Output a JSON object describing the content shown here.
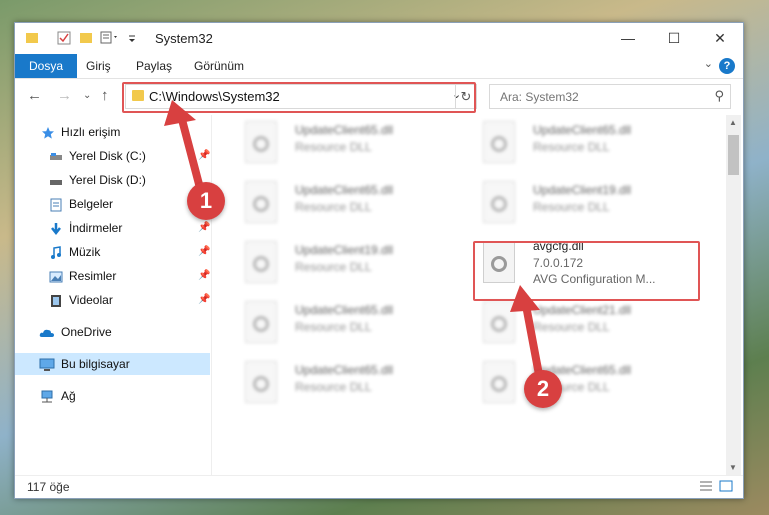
{
  "window": {
    "title": "System32"
  },
  "ribbon": {
    "tabs": [
      "Dosya",
      "Giriş",
      "Paylaş",
      "Görünüm"
    ],
    "help_label": "?"
  },
  "address": {
    "path": "C:\\Windows\\System32",
    "search_placeholder": "Ara: System32"
  },
  "sidebar": {
    "items": [
      {
        "label": "Hızlı erişim",
        "icon": "star-icon"
      },
      {
        "label": "Yerel Disk (C:)",
        "icon": "drive-icon",
        "pinned": true
      },
      {
        "label": "Yerel Disk (D:)",
        "icon": "drive-icon"
      },
      {
        "label": "Belgeler",
        "icon": "document-icon",
        "pinned": true
      },
      {
        "label": "İndirmeler",
        "icon": "download-icon",
        "pinned": true
      },
      {
        "label": "Müzik",
        "icon": "music-icon",
        "pinned": true
      },
      {
        "label": "Resimler",
        "icon": "pictures-icon",
        "pinned": true
      },
      {
        "label": "Videolar",
        "icon": "video-icon",
        "pinned": true
      },
      {
        "label": "OneDrive",
        "icon": "cloud-icon"
      },
      {
        "label": "Bu bilgisayar",
        "icon": "computer-icon",
        "selected": true
      },
      {
        "label": "Ağ",
        "icon": "network-icon"
      }
    ]
  },
  "files": [
    {
      "name": "UpdateClient65.dll",
      "sub": "Resource DLL",
      "blurred": true
    },
    {
      "name": "UpdateClient65.dll",
      "sub": "Resource DLL",
      "blurred": true
    },
    {
      "name": "UpdateClient65.dll",
      "sub": "Resource DLL",
      "blurred": true
    },
    {
      "name": "UpdateClient19.dll",
      "sub": "Resource DLL",
      "blurred": true
    },
    {
      "name": "UpdateClient19.dll",
      "sub": "Resource DLL",
      "blurred": true
    },
    {
      "name": "avgcfg.dll",
      "sub": "7.0.0.172",
      "sub2": "AVG Configuration M...",
      "blurred": false
    },
    {
      "name": "UpdateClient65.dll",
      "sub": "Resource DLL",
      "blurred": true
    },
    {
      "name": "UpdateClient21.dll",
      "sub": "Resource DLL",
      "blurred": true
    },
    {
      "name": "UpdateClient65.dll",
      "sub": "Resource DLL",
      "blurred": true
    },
    {
      "name": "UpdateClient65.dll",
      "sub": "Resource DLL",
      "blurred": true
    }
  ],
  "status": {
    "count": "117 öğe"
  },
  "annotations": {
    "badge1": "1",
    "badge2": "2"
  },
  "colors": {
    "accent": "#1979ca",
    "annotation": "#d84040",
    "selection": "#cce8ff"
  }
}
